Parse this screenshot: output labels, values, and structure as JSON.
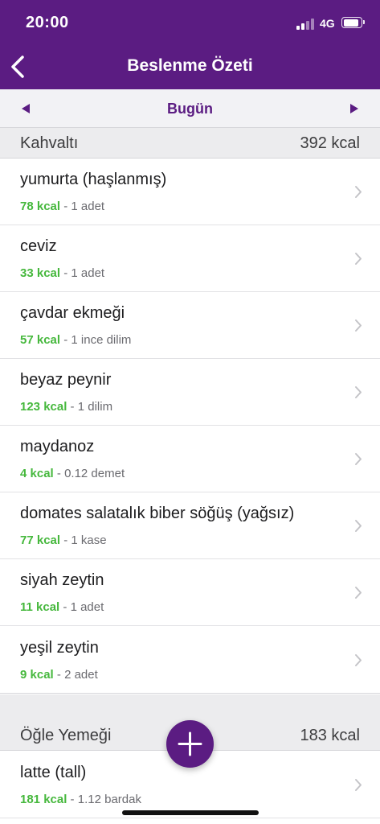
{
  "status_bar": {
    "time": "20:00",
    "network": "4G"
  },
  "nav": {
    "title": "Beslenme Özeti"
  },
  "date_selector": {
    "label": "Bugün"
  },
  "breakfast": {
    "title": "Kahvaltı",
    "total": "392 kcal",
    "items": [
      {
        "name": "yumurta (haşlanmış)",
        "kcal": "78 kcal",
        "sep": " - ",
        "amount": "1 adet"
      },
      {
        "name": "ceviz",
        "kcal": "33 kcal",
        "sep": " - ",
        "amount": "1 adet"
      },
      {
        "name": "çavdar ekmeği",
        "kcal": "57 kcal",
        "sep": " - ",
        "amount": "1 ince dilim"
      },
      {
        "name": "beyaz peynir",
        "kcal": "123 kcal",
        "sep": " - ",
        "amount": "1 dilim"
      },
      {
        "name": "maydanoz",
        "kcal": "4 kcal",
        "sep": " - ",
        "amount": "0.12 demet"
      },
      {
        "name": "domates salatalık biber söğüş (yağsız)",
        "kcal": "77 kcal",
        "sep": " - ",
        "amount": "1 kase"
      },
      {
        "name": "siyah zeytin",
        "kcal": "11 kcal",
        "sep": " - ",
        "amount": "1 adet"
      },
      {
        "name": "yeşil zeytin",
        "kcal": "9 kcal",
        "sep": " - ",
        "amount": "2 adet"
      }
    ]
  },
  "lunch": {
    "title": "Öğle Yemeği",
    "total": "183 kcal",
    "items": [
      {
        "name": "latte (tall)",
        "kcal": "181 kcal",
        "sep": " - ",
        "amount": "1.12 bardak"
      }
    ]
  },
  "colors": {
    "brand": "#5b1c82",
    "kcal": "#46b83d"
  },
  "icons": [
    "back-chevron-icon",
    "prev-arrow-icon",
    "next-arrow-icon",
    "row-chevron-icon",
    "plus-icon"
  ]
}
